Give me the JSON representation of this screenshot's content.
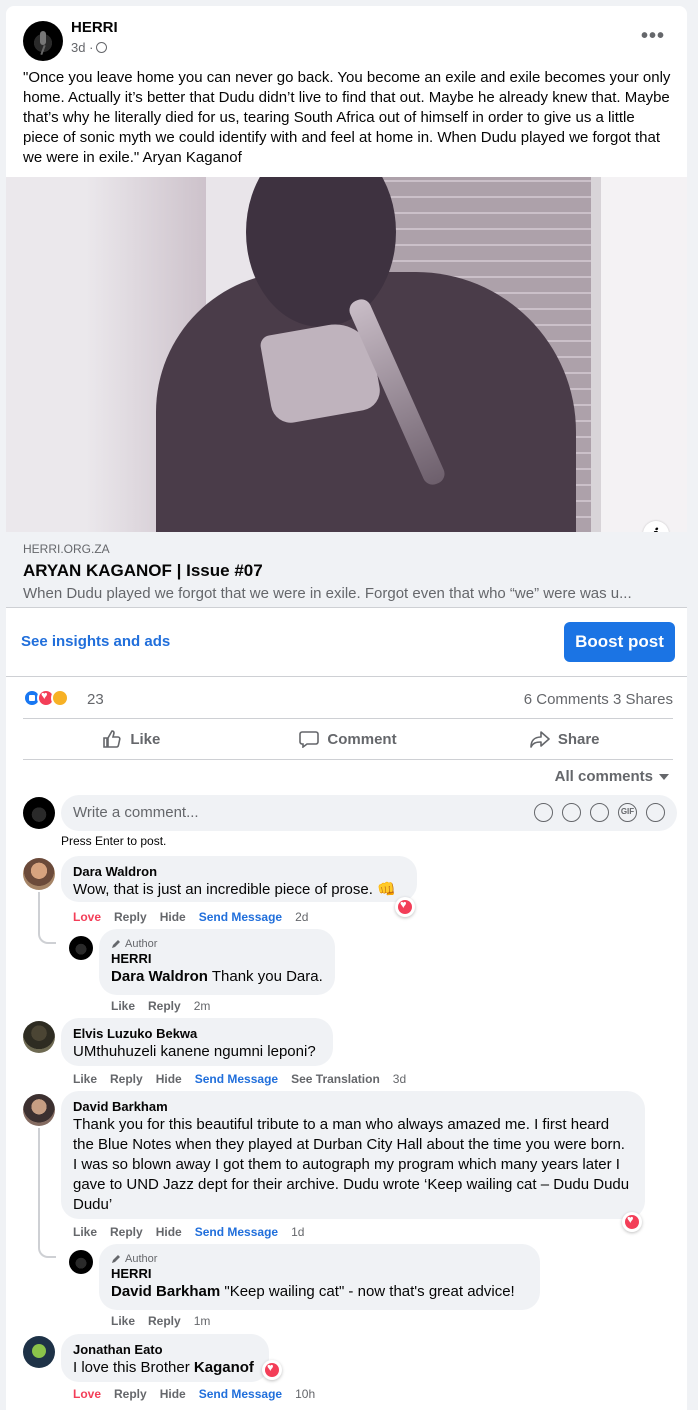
{
  "post": {
    "page_name": "HERRI",
    "time": "3d ·",
    "text": "\"Once you leave home you can never go back. You become an exile and exile becomes your only home. Actually it’s better that Dudu didn’t live to find that out. Maybe he already knew that. Maybe that’s why he literally died for us, tearing South Africa out of himself in order to give us a little piece of sonic myth we could identify with and feel at home in. When Dudu played we forgot that we were in exile.\" Aryan Kaganof",
    "more_icon": "•••"
  },
  "link": {
    "domain": "HERRI.ORG.ZA",
    "title": "ARYAN KAGANOF | Issue #07",
    "description": "When Dudu played we forgot that we were in exile. Forgot even that who “we” were was u...",
    "info_glyph": "i"
  },
  "insights": {
    "link_label": "See insights and ads",
    "boost_label": "Boost post"
  },
  "stats": {
    "reactions": "23",
    "comments": "6 Comments",
    "shares": "3 Shares"
  },
  "actions": {
    "like": "Like",
    "comment": "Comment",
    "share": "Share"
  },
  "comments_filter": "All comments",
  "composer": {
    "placeholder": "Write a comment...",
    "hint": "Press Enter to post.",
    "gif_label": "GIF"
  },
  "comments": [
    {
      "name": "Dara Waldron",
      "text": "Wow, that is just an incredible piece of prose. 👊",
      "actions": [
        "Love",
        "Reply",
        "Hide",
        "Send Message"
      ],
      "time": "2d"
    },
    {
      "author_label": "Author",
      "name": "HERRI",
      "mention": "Dara Waldron",
      "text": " Thank you Dara.",
      "actions": [
        "Like",
        "Reply"
      ],
      "time": "2m"
    },
    {
      "name": "Elvis Luzuko Bekwa",
      "text": "UMthuhuzeli kanene ngumni leponi?",
      "actions": [
        "Like",
        "Reply",
        "Hide",
        "Send Message",
        "See Translation"
      ],
      "time": "3d"
    },
    {
      "name": "David Barkham",
      "text": "Thank you for this beautiful tribute to a man who always amazed me. I first heard the Blue Notes when they played at Durban City Hall about the time you were born. I was so blown away I got them to autograph my program which many years later I gave to UND Jazz dept for their archive. Dudu wrote ‘Keep wailing cat – Dudu Dudu Dudu’",
      "actions": [
        "Like",
        "Reply",
        "Hide",
        "Send Message"
      ],
      "time": "1d"
    },
    {
      "author_label": "Author",
      "name": "HERRI",
      "mention": "David Barkham",
      "text": " \"Keep wailing cat\" - now that's great advice!",
      "actions": [
        "Like",
        "Reply"
      ],
      "time": "1m"
    },
    {
      "name": "Jonathan Eato",
      "text": "I love this Brother ",
      "mention": "Kaganof",
      "actions": [
        "Love",
        "Reply",
        "Hide",
        "Send Message"
      ],
      "time": "10h"
    }
  ],
  "colors": {
    "accent": "#1b74e4",
    "link_blue": "#216fdb",
    "love_red": "#f33e58",
    "muted": "#65676b",
    "bubble": "#f0f2f5"
  }
}
